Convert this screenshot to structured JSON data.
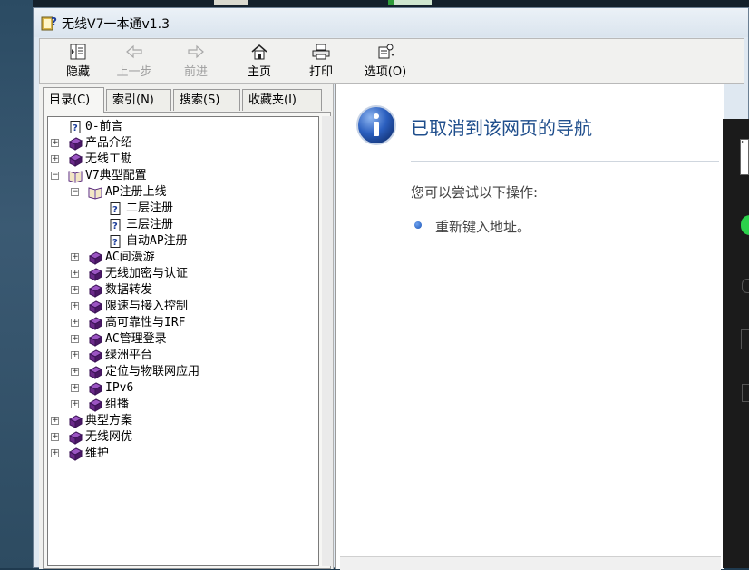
{
  "window": {
    "title": "无线V7一本通v1.3",
    "icon": "help-book-icon"
  },
  "toolbar": {
    "buttons": [
      {
        "label": "隐藏",
        "icon": "hide-pane-icon",
        "enabled": true
      },
      {
        "label": "上一步",
        "icon": "back-arrow-icon",
        "enabled": false
      },
      {
        "label": "前进",
        "icon": "forward-arrow-icon",
        "enabled": false
      },
      {
        "label": "主页",
        "icon": "home-icon",
        "enabled": true
      },
      {
        "label": "打印",
        "icon": "printer-icon",
        "enabled": true
      },
      {
        "label": "选项(O)",
        "icon": "options-icon",
        "enabled": true
      }
    ]
  },
  "tabs": [
    {
      "label": "目录(C)",
      "active": true
    },
    {
      "label": "索引(N)",
      "active": false
    },
    {
      "label": "搜索(S)",
      "active": false
    },
    {
      "label": "收藏夹(I)",
      "active": false
    }
  ],
  "tree": [
    {
      "label": "0-前言",
      "level": 0,
      "type": "page",
      "expander": "none"
    },
    {
      "label": "产品介绍",
      "level": 0,
      "type": "book",
      "expander": "plus"
    },
    {
      "label": "无线工勘",
      "level": 0,
      "type": "book",
      "expander": "plus"
    },
    {
      "label": "V7典型配置",
      "level": 0,
      "type": "book-open",
      "expander": "minus"
    },
    {
      "label": "AP注册上线",
      "level": 1,
      "type": "book-open",
      "expander": "minus"
    },
    {
      "label": "二层注册",
      "level": 2,
      "type": "page",
      "expander": "none"
    },
    {
      "label": "三层注册",
      "level": 2,
      "type": "page",
      "expander": "none"
    },
    {
      "label": "自动AP注册",
      "level": 2,
      "type": "page",
      "expander": "none"
    },
    {
      "label": "AC间漫游",
      "level": 1,
      "type": "book",
      "expander": "plus"
    },
    {
      "label": "无线加密与认证",
      "level": 1,
      "type": "book",
      "expander": "plus"
    },
    {
      "label": "数据转发",
      "level": 1,
      "type": "book",
      "expander": "plus"
    },
    {
      "label": "限速与接入控制",
      "level": 1,
      "type": "book",
      "expander": "plus"
    },
    {
      "label": "高可靠性与IRF",
      "level": 1,
      "type": "book",
      "expander": "plus"
    },
    {
      "label": "AC管理登录",
      "level": 1,
      "type": "book",
      "expander": "plus"
    },
    {
      "label": "绿洲平台",
      "level": 1,
      "type": "book",
      "expander": "plus"
    },
    {
      "label": "定位与物联网应用",
      "level": 1,
      "type": "book",
      "expander": "plus"
    },
    {
      "label": "IPv6",
      "level": 1,
      "type": "book",
      "expander": "plus"
    },
    {
      "label": "组播",
      "level": 1,
      "type": "book",
      "expander": "plus"
    },
    {
      "label": "典型方案",
      "level": 0,
      "type": "book",
      "expander": "plus"
    },
    {
      "label": "无线网优",
      "level": 0,
      "type": "book",
      "expander": "plus"
    },
    {
      "label": "维护",
      "level": 0,
      "type": "book",
      "expander": "plus"
    }
  ],
  "content": {
    "title": "已取消到该网页的导航",
    "subtitle": "您可以尝试以下操作:",
    "items": [
      "重新键入地址。"
    ],
    "icon": "info-icon"
  },
  "overlay": {
    "input_value": "\""
  },
  "colors": {
    "title_blue": "#1f4e8c",
    "book_purple": "#6b2a8a",
    "window_bg": "#dfe8f1"
  }
}
